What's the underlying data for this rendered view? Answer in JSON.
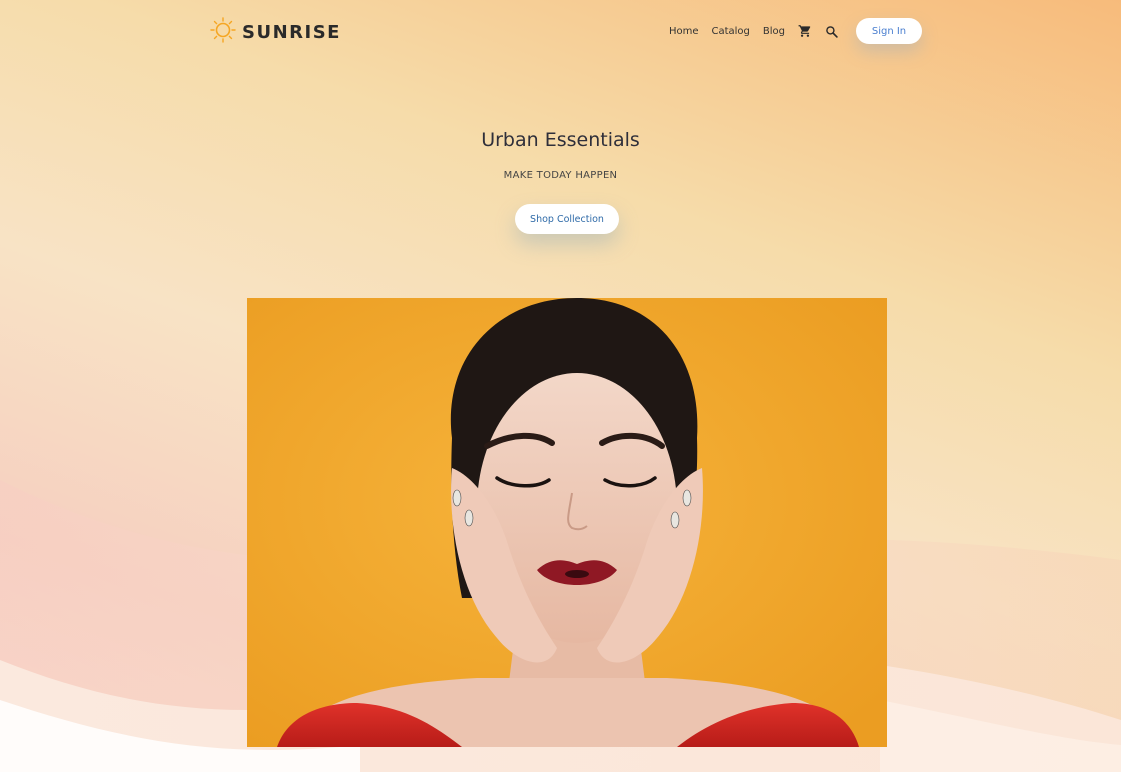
{
  "brand": {
    "name": "SUNRISE",
    "logo_icon": "sun-icon",
    "accent_color": "#f5a623"
  },
  "nav": {
    "links": [
      "Home",
      "Catalog",
      "Blog"
    ],
    "cart_icon": "cart-icon",
    "search_icon": "search-icon",
    "signin_label": "Sign In"
  },
  "hero": {
    "title": "Urban Essentials",
    "subtitle": "MAKE TODAY HAPPEN",
    "cta_label": "Shop Collection",
    "image_subject": "woman-portrait-yellow-background"
  },
  "colors": {
    "button_text": "#2e6aa8",
    "image_background": "#f1a72e",
    "dress": "#d8261f"
  }
}
